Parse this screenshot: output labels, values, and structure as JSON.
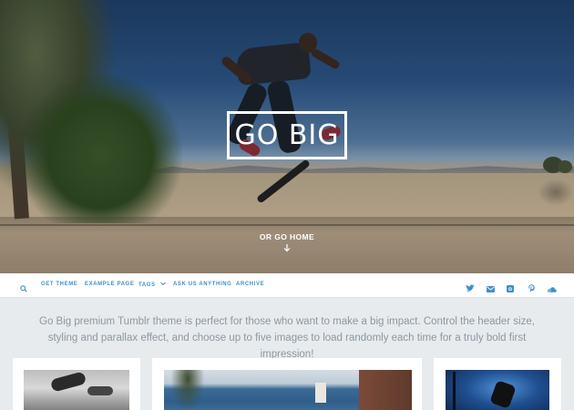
{
  "hero": {
    "logo": "GO BIG",
    "tagline": "OR GO HOME"
  },
  "nav": {
    "items": [
      {
        "label": "GET THEME"
      },
      {
        "label": "EXAMPLE PAGE"
      },
      {
        "label": "TAGS"
      },
      {
        "label": "ASK US ANYTHING"
      },
      {
        "label": "ARCHIVE"
      }
    ],
    "social_icons": [
      "twitter-icon",
      "mail-icon",
      "instagram-icon",
      "pinterest-icon",
      "soundcloud-icon"
    ],
    "accent_color": "#3f90c9"
  },
  "intro": {
    "text": "Go Big premium Tumblr theme is perfect for those who want to make a big impact. Control the header size, styling and parallax effect, and choose up to five images to load randomly each time for a truly bold first impression!"
  }
}
